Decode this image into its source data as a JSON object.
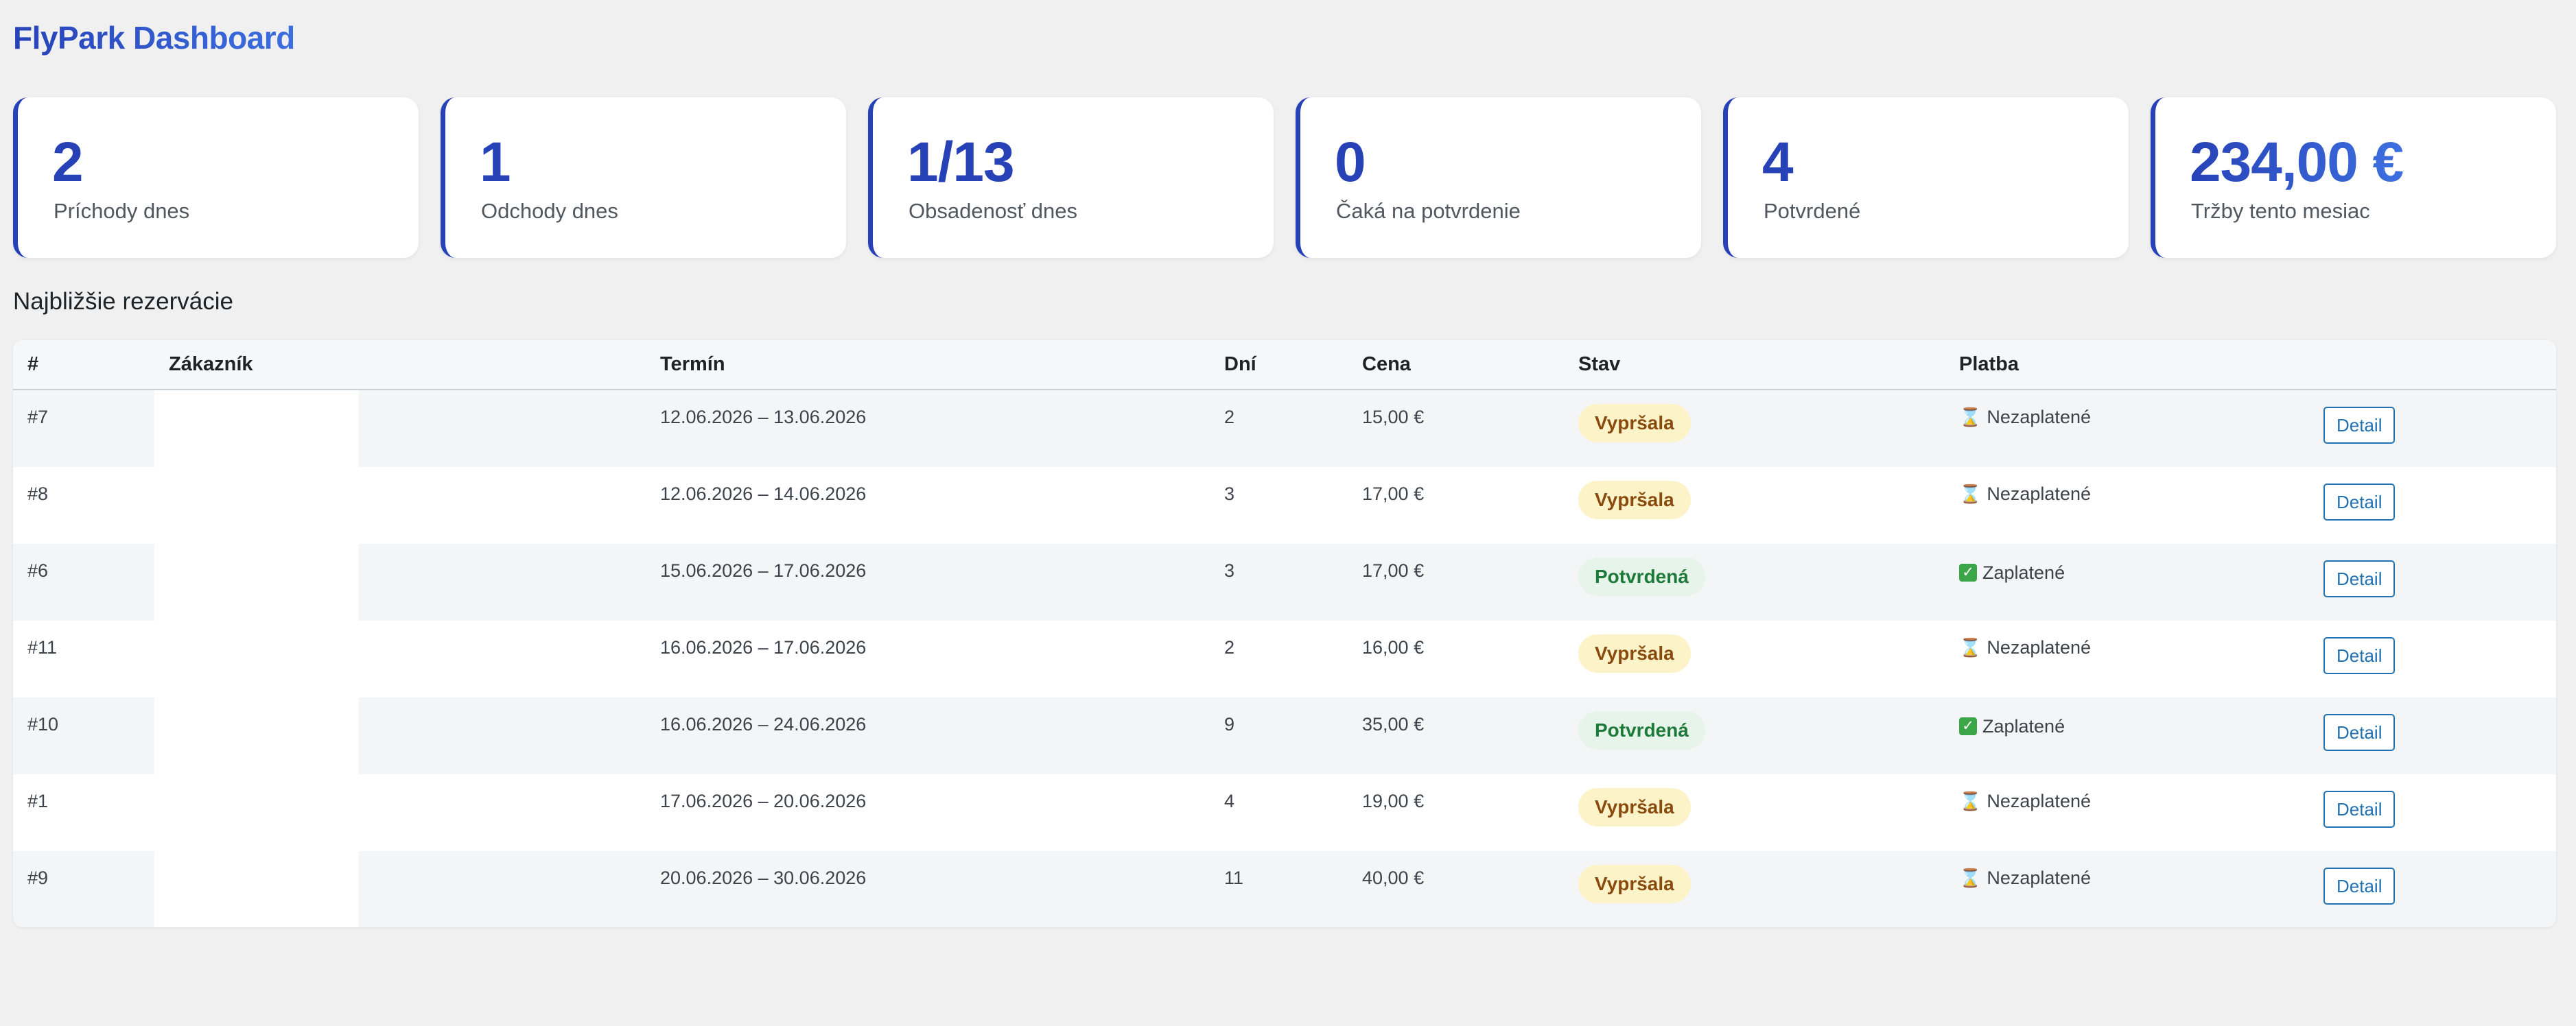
{
  "header": {
    "title": "FlyPark Dashboard"
  },
  "cards": [
    {
      "value": "2",
      "label": "Príchody dnes"
    },
    {
      "value": "1",
      "label": "Odchody dnes"
    },
    {
      "value": "1/13",
      "label": "Obsadenosť dnes"
    },
    {
      "value": "0",
      "label": "Čaká na potvrdenie"
    },
    {
      "value": "4",
      "label": "Potvrdené"
    },
    {
      "value": "234,00 €",
      "label": "Tržby tento mesiac"
    }
  ],
  "section": {
    "title": "Najbližšie rezervácie"
  },
  "table": {
    "columns": [
      "#",
      "Zákazník",
      "Termín",
      "Dní",
      "Cena",
      "Stav",
      "Platba",
      ""
    ],
    "rows": [
      {
        "id": "#7",
        "term": "12.06.2026 – 13.06.2026",
        "days": "2",
        "price": "15,00 €",
        "status": "Vypršala",
        "status_type": "expired",
        "payment": "Nezaplatené",
        "paid": false,
        "action": "Detail"
      },
      {
        "id": "#8",
        "term": "12.06.2026 – 14.06.2026",
        "days": "3",
        "price": "17,00 €",
        "status": "Vypršala",
        "status_type": "expired",
        "payment": "Nezaplatené",
        "paid": false,
        "action": "Detail"
      },
      {
        "id": "#6",
        "term": "15.06.2026 – 17.06.2026",
        "days": "3",
        "price": "17,00 €",
        "status": "Potvrdená",
        "status_type": "confirmed",
        "payment": "Zaplatené",
        "paid": true,
        "action": "Detail"
      },
      {
        "id": "#11",
        "term": "16.06.2026 – 17.06.2026",
        "days": "2",
        "price": "16,00 €",
        "status": "Vypršala",
        "status_type": "expired",
        "payment": "Nezaplatené",
        "paid": false,
        "action": "Detail"
      },
      {
        "id": "#10",
        "term": "16.06.2026 – 24.06.2026",
        "days": "9",
        "price": "35,00 €",
        "status": "Potvrdená",
        "status_type": "confirmed",
        "payment": "Zaplatené",
        "paid": true,
        "action": "Detail"
      },
      {
        "id": "#1",
        "term": "17.06.2026 – 20.06.2026",
        "days": "4",
        "price": "19,00 €",
        "status": "Vypršala",
        "status_type": "expired",
        "payment": "Nezaplatené",
        "paid": false,
        "action": "Detail"
      },
      {
        "id": "#9",
        "term": "20.06.2026 – 30.06.2026",
        "days": "11",
        "price": "40,00 €",
        "status": "Vypršala",
        "status_type": "expired",
        "payment": "Nezaplatené",
        "paid": false,
        "action": "Detail"
      }
    ]
  },
  "icons": {
    "unpaid": "hourglass-icon",
    "paid": "check-mark-icon"
  },
  "colors": {
    "accent": "#2742b7",
    "expired_bg": "#fdf3c8",
    "confirmed_bg": "#e6f4e9"
  }
}
